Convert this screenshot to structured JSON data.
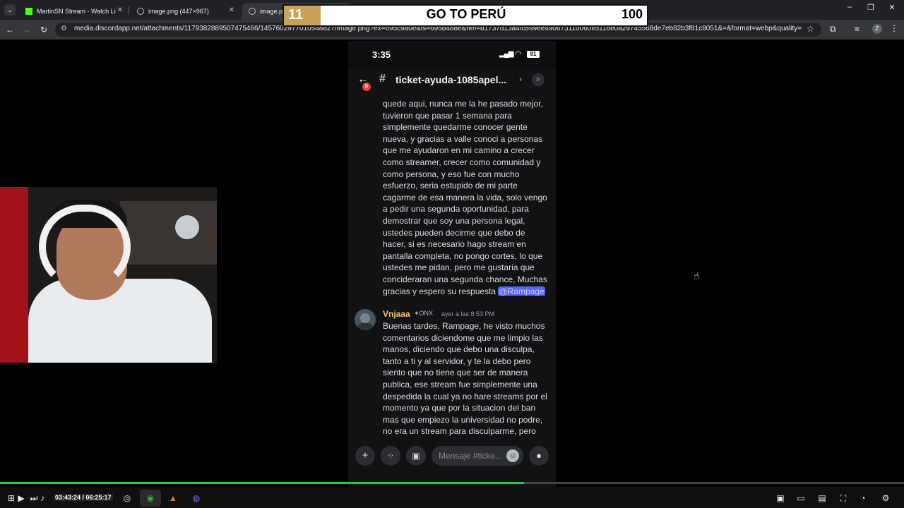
{
  "browser": {
    "tabs": [
      {
        "label": "MartinSN Stream - Watch Live o",
        "favicon": "kick-icon",
        "color": "#53fc18"
      },
      {
        "label": "image.png (447×967)",
        "favicon": "globe-icon"
      },
      {
        "label": "image.png",
        "favicon": "globe-icon"
      }
    ],
    "url": "media.discordapp.net/attachments/1179382889507475466/1457602977010548827/image.png?ex=695c9a0e&is=695b488e&hm=b1737d13a4fc899ee490673110060ff5116e0a29745568de7eb82b3f81c8051&=&format=webp&quality=lossless&widt..."
  },
  "scoreboard": {
    "left_number": "11",
    "title": "GO TO PERÚ",
    "right_number": "100"
  },
  "phone": {
    "time": "3:35",
    "battery": "91",
    "channel": "ticket-ayuda-1085apel...",
    "badge_count": "9",
    "message1_lines": [
      "quede aqui, nunca me la he pasado mejor,",
      "tuvieron que pasar 1 semana para",
      "simplemente quedarme conocer gente",
      "nueva, y gracias a valle conoci a personas",
      "que me ayudaron en mi camino a crecer",
      "como streamer,  crecer como comunidad y",
      "como persona, y eso fue con mucho",
      "esfuerzo, seria estupido de mi parte",
      "cagarme de esa manera la vida, solo vengo",
      "a pedir una segunda oportunidad, para",
      "demostrar que soy una persona legal,",
      "ustedes pueden decirme que debo de",
      "hacer, si es necesario hago stream en",
      "pantalla completa, no pongo cortes, lo que",
      "ustedes me pidan, pero me gustaria que",
      "concideraran una segunda chance, Muchas"
    ],
    "message1_last": "gracias y espero su respuesta ",
    "mention": "@Rampage",
    "message2": {
      "username": "Vnjaaa",
      "tag": "ONX",
      "time": "ayer a las 8:53 PM",
      "lines": [
        "Buenas tardes, Rampage, he visto muchos",
        "comentarios diciendome que me limpio las",
        "manos,  diciendo que debo una disculpa,",
        "tanto a ti y al servidor, y te la debo pero",
        "siento que no tiene que ser de manera",
        "publica, ese stream fue simplemente una",
        "despedida la cual ya no hare streams por el",
        "momento ya que por la situacion del ban",
        "mas que empiezo la universidad no podre,",
        "no era un stream para disculparme, pero"
      ]
    },
    "input_placeholder": "Mensaje #ticke..."
  },
  "player": {
    "time": "03:43:24 / 06:25:17",
    "progress": 0.58
  }
}
